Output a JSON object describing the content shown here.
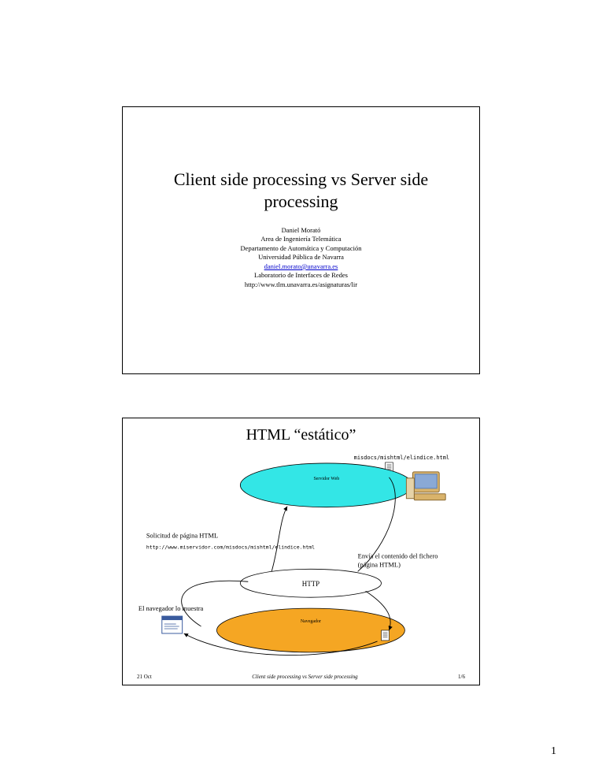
{
  "page_number": "1",
  "slide1": {
    "title": "Client side processing vs Server side processing",
    "author": "Daniel Morató",
    "dept1": "Area de Ingeniería Telemática",
    "dept2": "Departamento de Automática y Computación",
    "univ": "Universidad Pública de Navarra",
    "email": "daniel.morato@unavarra.es",
    "lab": "Laboratorio de Interfaces de Redes",
    "url": "http://www.tlm.unavarra.es/asignaturas/lir"
  },
  "slide2": {
    "title": "HTML “estático”",
    "path_label": "misdocs/mishtml/elindice.html",
    "server_label": "Servidor Web",
    "req_label": "Solicitud de página HTML",
    "req_url": "http://www.miservidor.com/misdocs/mishtml/elindice.html",
    "http_label": "HTTP",
    "resp_label1": "Envía el contenido del fichero",
    "resp_label2": "(página HTML)",
    "show_label": "El navegador lo muestra",
    "browser_label": "Navegador",
    "footer_date": "21 Oct",
    "footer_mid": "Client side processing vs Server side processing",
    "footer_page": "1/6"
  }
}
